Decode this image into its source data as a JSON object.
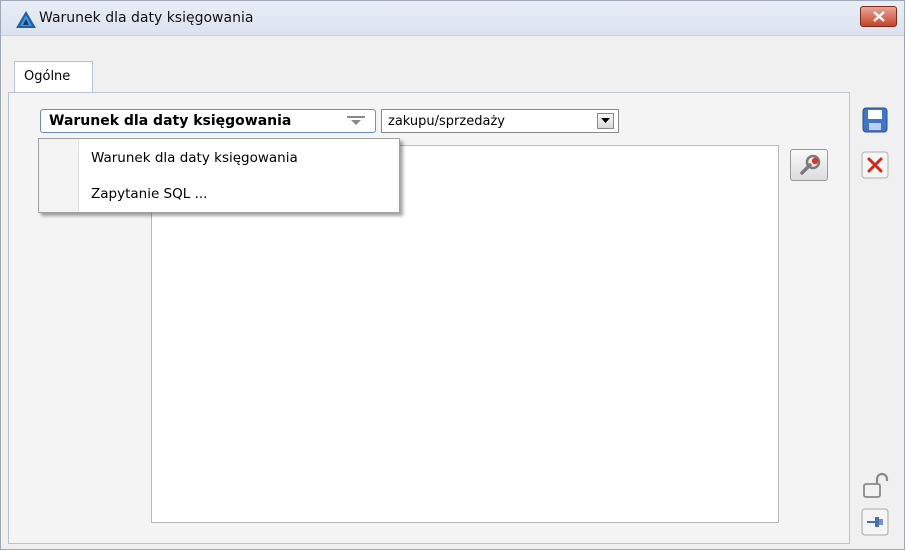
{
  "window": {
    "title": "Warunek dla daty księgowania",
    "icons": {
      "app": "app-logo-icon",
      "close": "close-icon"
    }
  },
  "tabs": [
    {
      "label": "Ogólne",
      "active": true
    }
  ],
  "condition": {
    "selected": "Warunek dla daty księgowania",
    "type_selected": "zakupu/sprzedaży"
  },
  "dropdown": {
    "open": true,
    "items": [
      {
        "label": "Warunek dla daty księgowania"
      },
      {
        "label": "Zapytanie SQL ..."
      }
    ]
  },
  "editor": {
    "value": ""
  },
  "sidebar": {
    "icons": [
      "save-icon",
      "cancel-icon",
      "unlock-icon",
      "pin-icon"
    ]
  },
  "colors": {
    "title_bar": "#dbe3ee",
    "close_button": "#c7432b",
    "combo_border": "#6a8ec0"
  }
}
